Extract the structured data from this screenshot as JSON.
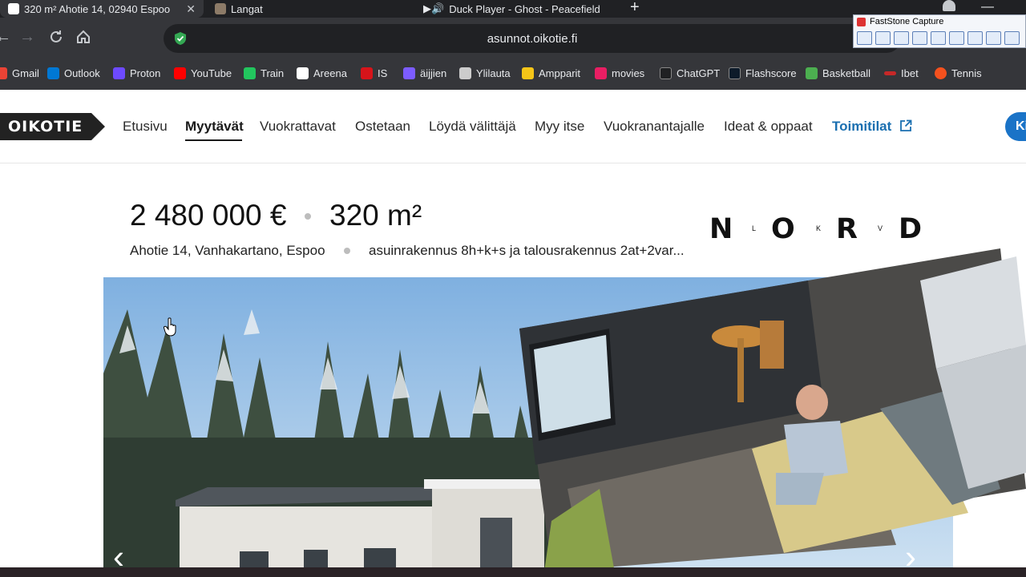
{
  "browser": {
    "tabs": [
      {
        "title": "320 m² Ahotie 14, 02940 Espoo",
        "active": true
      },
      {
        "title": "Langat",
        "active": false
      },
      {
        "title": "Duck Player - Ghost - Peacefield",
        "active": false
      }
    ],
    "url": "asunnot.oikotie.fi",
    "bookmarks": [
      {
        "label": "Gmail",
        "color": "#ea4335"
      },
      {
        "label": "Outlook",
        "color": "#0078d4"
      },
      {
        "label": "Proton",
        "color": "#6d4aff"
      },
      {
        "label": "YouTube",
        "color": "#ff0000"
      },
      {
        "label": "Train",
        "color": "#22c55e"
      },
      {
        "label": "Areena",
        "color": "#ffffff"
      },
      {
        "label": "IS",
        "color": "#d7141a"
      },
      {
        "label": "äijjien",
        "color": "#7c5cff"
      },
      {
        "label": "Ylilauta",
        "color": "#cccccc"
      },
      {
        "label": "Ampparit",
        "color": "#f5c518"
      },
      {
        "label": "movies",
        "color": "#e91e63"
      },
      {
        "label": "ChatGPT",
        "color": "#202123"
      },
      {
        "label": "Flashscore",
        "color": "#0d1b2a"
      },
      {
        "label": "Basketball",
        "color": "#4caf50"
      },
      {
        "label": "Ibet",
        "color": "#c62828"
      },
      {
        "label": "Tennis",
        "color": "#f4511e"
      }
    ],
    "overlay_title": "FastStone Capture"
  },
  "site": {
    "logo": "OIKOTIE",
    "nav": [
      "Etusivu",
      "Myytävät",
      "Vuokrattavat",
      "Ostetaan",
      "Löydä välittäjä",
      "Myy itse",
      "Vuokranantajalle",
      "Ideat & oppaat"
    ],
    "active_nav": "Myytävät",
    "business_link": "Toimitilat",
    "cta_label": "Ki"
  },
  "listing": {
    "price": "2 480 000 €",
    "area": "320 m²",
    "address": "Ahotie 14, Vanhakartano, Espoo",
    "description": "asuinrakennus 8h+k+s ja talousrakennus 2at+2var...",
    "agency_logo": [
      "N",
      "L",
      "O",
      "K",
      "R",
      "V",
      "D"
    ]
  },
  "colors": {
    "brand_dark": "#222222",
    "link_blue": "#1a6fb0",
    "cta_blue": "#1a73c7"
  }
}
